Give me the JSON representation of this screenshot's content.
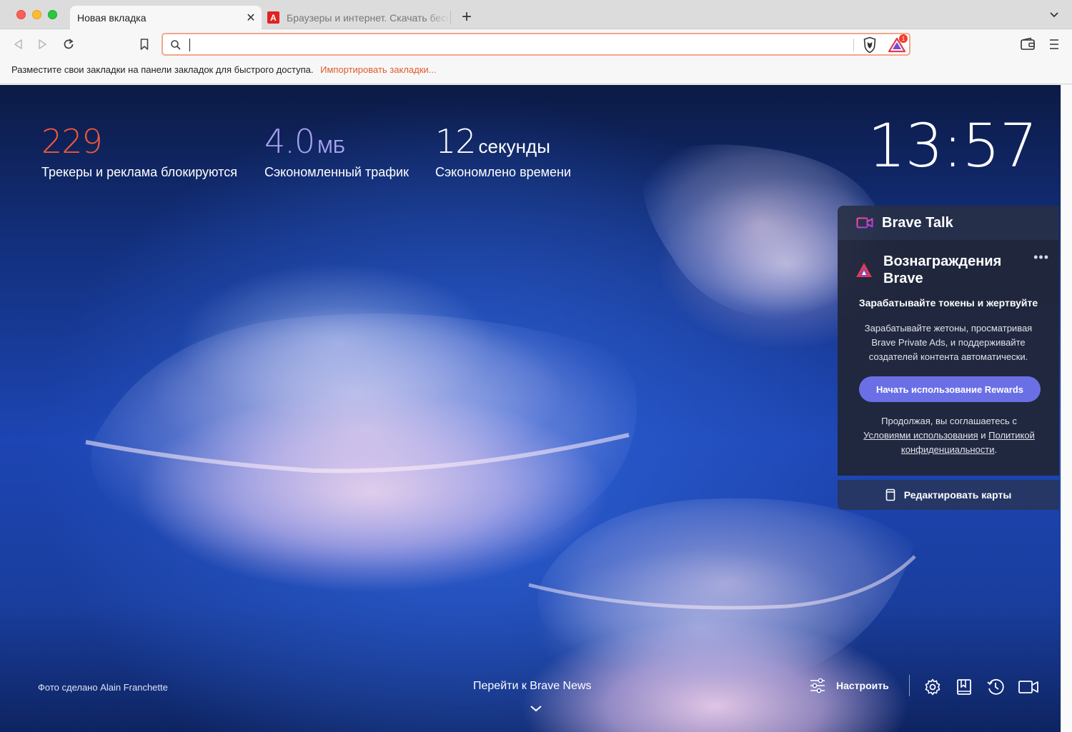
{
  "tabs": [
    {
      "title": "Новая вкладка",
      "active": true,
      "close_glyph": "✕"
    },
    {
      "title": "Браузеры и интернет. Скачать бесплатно",
      "active": false,
      "favicon_letter": "A"
    }
  ],
  "new_tab_glyph": "+",
  "tab_menu_glyph": "⌄",
  "toolbar": {
    "back_glyph": "◁",
    "forward_glyph": "▷",
    "reload_glyph": "↻",
    "url_value": "",
    "url_placeholder": "",
    "rewards_badge": "1"
  },
  "bookmarks_bar": {
    "text": "Разместите свои закладки на панели закладок для быстрого доступа.",
    "import_link": "Импортировать закладки..."
  },
  "stats": {
    "trackers": {
      "value": "229",
      "label": "Трекеры и реклама блокируются"
    },
    "bandwidth": {
      "value": "4.0",
      "unit": "МБ",
      "label": "Сэкономленный трафик"
    },
    "time": {
      "value": "12",
      "unit": "секунды",
      "label": "Сэкономлено времени"
    }
  },
  "clock": "13:57",
  "brave_talk": {
    "label": "Brave Talk"
  },
  "rewards": {
    "title": "Вознаграждения Brave",
    "more_glyph": "•••",
    "subtitle": "Зарабатывайте токены и жертвуйте",
    "text": "Зарабатывайте жетоны, просматривая Brave Private Ads, и поддерживайте создателей контента автоматически.",
    "button": "Начать использование Rewards",
    "terms_prefix": "Продолжая, вы соглашаетесь с",
    "terms_link": "Условиями использования",
    "terms_and": "и",
    "privacy_link": "Политикой конфиденциальности",
    "terms_suffix": "."
  },
  "edit_cards": "Редактировать карты",
  "photo_credit": "Фото сделано Alain Franchette",
  "news_link": "Перейти к Brave News",
  "customize": "Настроить",
  "colors": {
    "accent_orange": "#f0573b",
    "accent_purple": "#a8a3f4",
    "rewards_button": "#6b6fe6",
    "import_link": "#e05a2b"
  }
}
